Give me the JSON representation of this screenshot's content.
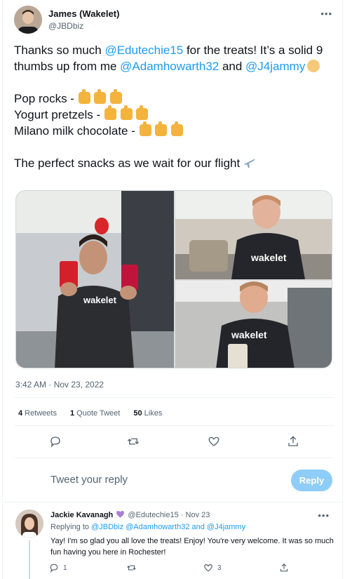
{
  "tweet": {
    "author_name": "James (Wakelet)",
    "author_handle": "@JBDbiz",
    "text": {
      "p1_a": "Thanks so much ",
      "p1_mention1": "@Edutechie15",
      "p1_b": " for the treats! It’s a solid 9 thumbs up from me ",
      "p1_mention2": "@Adamhowarth32",
      "p1_c": " and ",
      "p1_mention3": "@J4jammy",
      "line_pop": "Pop rocks - ",
      "line_yogurt": "Yogurt pretzels - ",
      "line_milano": "Milano milk chocolate - ",
      "line_flight": "The perfect snacks as we wait for our flight"
    },
    "emoji": {
      "thumbs_up": "thumbs-up-emoji",
      "clap": "clapping-hands-emoji",
      "airplane": "airplane-emoji"
    },
    "photos": [
      {
        "logo": "wakelet"
      },
      {
        "logo": "wakelet"
      },
      {
        "logo": "wakelet"
      }
    ],
    "timestamp": "3:42 AM · Nov 23, 2022",
    "stats": {
      "retweets_count": "4",
      "retweets_label": "Retweets",
      "quotes_count": "1",
      "quotes_label": "Quote Tweet",
      "likes_count": "50",
      "likes_label": "Likes"
    },
    "actions": [
      "reply-icon",
      "retweet-icon",
      "like-icon",
      "share-icon"
    ]
  },
  "composer": {
    "placeholder": "Tweet your reply",
    "button_label": "Reply"
  },
  "reply": {
    "author_name": "Jackie Kavanagh",
    "author_handle": "@Edutechie15",
    "date": " · Nov 23",
    "replying_to_label": "Replying to ",
    "replying_to_1": "@JBDbiz",
    "replying_to_2": "@Adamhowarth32",
    "replying_to_and": " and ",
    "replying_to_3": "@J4jammy",
    "text": "Yay!  I'm so glad you all love the treats!  Enjoy!  You're very welcome.  It was so much fun having you here in Rochester!",
    "reply_count": "1",
    "like_count": "3"
  },
  "colors": {
    "accent": "#1d9bf0",
    "reply_button_disabled": "#8ecdf8",
    "muted_text": "#536471",
    "border": "#eff3f4"
  }
}
